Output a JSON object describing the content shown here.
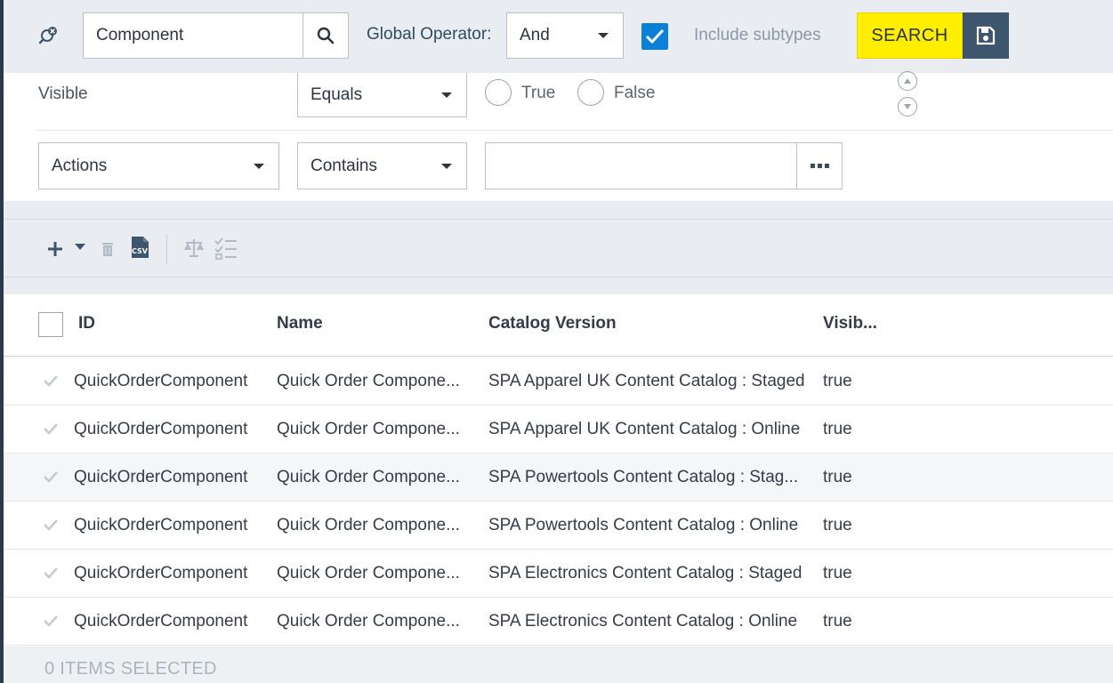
{
  "search": {
    "query": "Component",
    "global_operator_label": "Global Operator:",
    "global_operator_value": "And",
    "include_subtypes_checked": true,
    "include_subtypes_label": "Include subtypes",
    "search_button": "SEARCH"
  },
  "criteria": [
    {
      "field": "Visible",
      "operator": "Equals",
      "options": [
        "True",
        "False"
      ]
    },
    {
      "field": "Actions",
      "operator": "Contains",
      "value": ""
    }
  ],
  "toolbar": {
    "icons": [
      "add-icon",
      "dropdown-caret-icon",
      "delete-icon",
      "csv-export-icon",
      "compare-icon",
      "checklist-icon"
    ]
  },
  "grid": {
    "columns": [
      "ID",
      "Name",
      "Catalog Version",
      "Visib..."
    ],
    "rows": [
      {
        "id": "QuickOrderComponent",
        "name": "Quick Order Compone...",
        "catalog": "SPA Apparel UK Content Catalog : Staged",
        "visible": "true"
      },
      {
        "id": "QuickOrderComponent",
        "name": "Quick Order Compone...",
        "catalog": "SPA Apparel UK Content Catalog : Online",
        "visible": "true"
      },
      {
        "id": "QuickOrderComponent",
        "name": "Quick Order Compone...",
        "catalog": "SPA Powertools Content Catalog : Stag...",
        "visible": "true"
      },
      {
        "id": "QuickOrderComponent",
        "name": "Quick Order Compone...",
        "catalog": "SPA Powertools Content Catalog : Online",
        "visible": "true"
      },
      {
        "id": "QuickOrderComponent",
        "name": "Quick Order Compone...",
        "catalog": "SPA Electronics Content Catalog : Staged",
        "visible": "true"
      },
      {
        "id": "QuickOrderComponent",
        "name": "Quick Order Compone...",
        "catalog": "SPA Electronics Content Catalog : Online",
        "visible": "true"
      }
    ]
  },
  "footer": {
    "selection_status": "0 ITEMS SELECTED"
  },
  "colors": {
    "search_button": "#ffee00",
    "save_button": "#3e556e",
    "checkbox": "#0a80d6",
    "panel_bg": "#e9edf2"
  }
}
